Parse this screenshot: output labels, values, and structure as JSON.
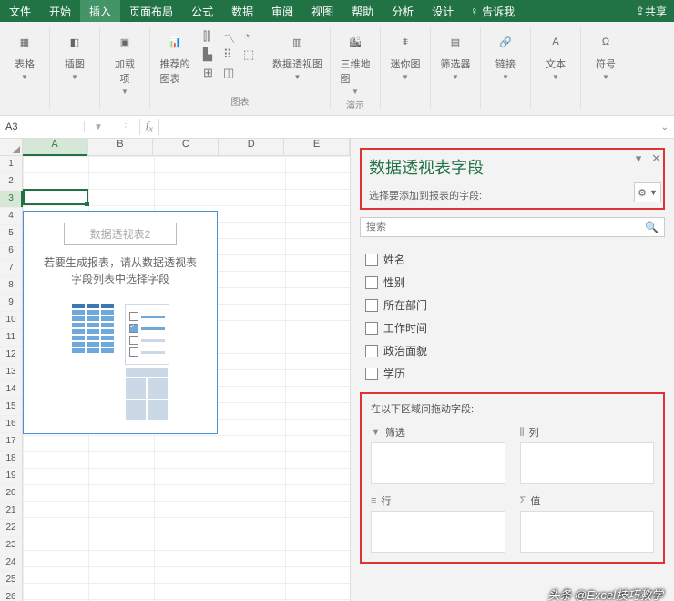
{
  "tabs": {
    "file": "文件",
    "home": "开始",
    "insert": "插入",
    "layout": "页面布局",
    "formula": "公式",
    "data": "数据",
    "review": "审阅",
    "view": "视图",
    "help": "帮助",
    "analyze": "分析",
    "design": "设计",
    "tellme": "告诉我",
    "share": "共享"
  },
  "ribbon": {
    "table": "表格",
    "illus": "插图",
    "addins": "加载\n项",
    "recomm": "推荐的\n图表",
    "pivotchart": "数据透视图",
    "map3d": "三维地\n图",
    "spark": "迷你图",
    "slicer": "筛选器",
    "link": "链接",
    "text": "文本",
    "symbol": "符号",
    "grp_illus": "",
    "grp_chart": "图表",
    "grp_tour": "演示"
  },
  "namebox": "A3",
  "pivot": {
    "title": "数据透视表2",
    "msg1": "若要生成报表，请从数据透视表",
    "msg2": "字段列表中选择字段"
  },
  "pane": {
    "title": "数据透视表字段",
    "sub": "选择要添加到报表的字段:",
    "search_ph": "搜索",
    "fields": [
      "姓名",
      "性别",
      "所在部门",
      "工作时间",
      "政治面貌",
      "学历"
    ],
    "draghdr": "在以下区域间拖动字段:",
    "filter": "筛选",
    "cols": "列",
    "rows": "行",
    "values": "值"
  },
  "cols": [
    "A",
    "B",
    "C",
    "D",
    "E"
  ],
  "watermark": "头条 @Excel技巧教学"
}
